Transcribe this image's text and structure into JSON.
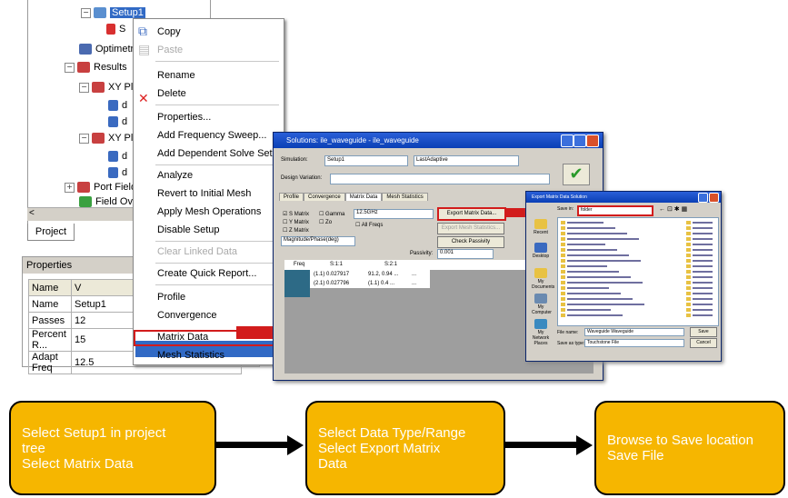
{
  "tree": {
    "items": [
      {
        "label": "Setup1",
        "selected": true
      },
      {
        "label": "S"
      },
      {
        "label": "Optimetric"
      },
      {
        "label": "Results"
      },
      {
        "label": "XY Pl"
      },
      {
        "label": "d"
      },
      {
        "label": "d"
      },
      {
        "label": "XY Pl"
      },
      {
        "label": "d"
      },
      {
        "label": "d"
      },
      {
        "label": "Port Field"
      },
      {
        "label": "Field Ove"
      }
    ],
    "project_tab": "Project"
  },
  "properties": {
    "title": "Properties",
    "headers": [
      "Name",
      "V"
    ],
    "rows": [
      [
        "Name",
        "Setup1"
      ],
      [
        "Passes",
        "12"
      ],
      [
        "Percent R...",
        "15"
      ],
      [
        "Adapt Freq",
        "12.5"
      ]
    ]
  },
  "context_menu": {
    "items": [
      {
        "label": "Copy",
        "disabled": false
      },
      {
        "label": "Paste",
        "disabled": true
      },
      {
        "label": "Rename",
        "disabled": false
      },
      {
        "label": "Delete",
        "disabled": false
      },
      {
        "label": "Properties...",
        "disabled": false
      },
      {
        "label": "Add Frequency Sweep...",
        "disabled": false
      },
      {
        "label": "Add Dependent Solve Setup",
        "disabled": false
      },
      {
        "label": "Analyze",
        "disabled": false
      },
      {
        "label": "Revert to Initial Mesh",
        "disabled": false
      },
      {
        "label": "Apply Mesh Operations",
        "disabled": false
      },
      {
        "label": "Disable Setup",
        "disabled": false
      },
      {
        "label": "Clear Linked Data",
        "disabled": true
      },
      {
        "label": "Create Quick Report...",
        "disabled": false
      },
      {
        "label": "Profile",
        "disabled": false
      },
      {
        "label": "Convergence",
        "disabled": false
      },
      {
        "label": "Matrix Data",
        "disabled": false,
        "highlighted": true
      },
      {
        "label": "Mesh Statistics",
        "disabled": false
      }
    ]
  },
  "dialog1": {
    "title": "Solutions: ile_waveguide - ile_waveguide",
    "simulation_label": "Simulation:",
    "simulation_value": "Setup1",
    "sweep_value": "LastAdaptive",
    "design_variation_label": "Design Variation:",
    "tabs": [
      "Profile",
      "Convergence",
      "Matrix Data",
      "Mesh Statistics"
    ],
    "active_tab": "Matrix Data",
    "checkboxes": [
      "S Matrix",
      "Y Matrix",
      "Z Matrix",
      "Gamma",
      "Zo",
      "All Freqs"
    ],
    "freq_value": "12.5GHz",
    "format_value": "Magnitude/Phase(deg)",
    "buttons": [
      "Export Matrix Data...",
      "Export Mesh Statistics...",
      "Check Passivity"
    ],
    "passivity_label": "Passivity:",
    "passivity_value": "0.001",
    "grid_headers": [
      "Freq",
      "S:1:1",
      "S:2:1"
    ],
    "grid_rows": [
      [
        "",
        "(1.1) 0.027917",
        "91.2, 0.94  ...",
        "..."
      ],
      [
        "",
        "(2.1) 0.027796",
        "(1.1) 0.4  ...",
        "..."
      ]
    ]
  },
  "dialog2": {
    "title": "Export Matrix Data Solution",
    "save_in_label": "Save in:",
    "save_in_value": "folder",
    "side_icons": [
      "Recent",
      "Desktop",
      "My Documents",
      "My Computer",
      "My Network Places"
    ],
    "file_name_label": "File name:",
    "file_name_value": "Waveguide Waveguide",
    "save_type_label": "Save as type:",
    "save_type_value": "Touchstone File",
    "save_button": "Save",
    "cancel_button": "Cancel"
  },
  "steps": [
    {
      "lines": [
        "Select Setup1 in project",
        "tree",
        "Select Matrix Data"
      ]
    },
    {
      "lines": [
        "Select Data Type/Range",
        "Select Export Matrix",
        "Data"
      ]
    },
    {
      "lines": [
        "Browse to Save location",
        "Save File"
      ]
    }
  ],
  "colors": {
    "step_box": "#f6b600",
    "highlight_box": "#d21c1c",
    "menu_highlight": "#316ac5",
    "title_bar": "#0a3fb5"
  }
}
